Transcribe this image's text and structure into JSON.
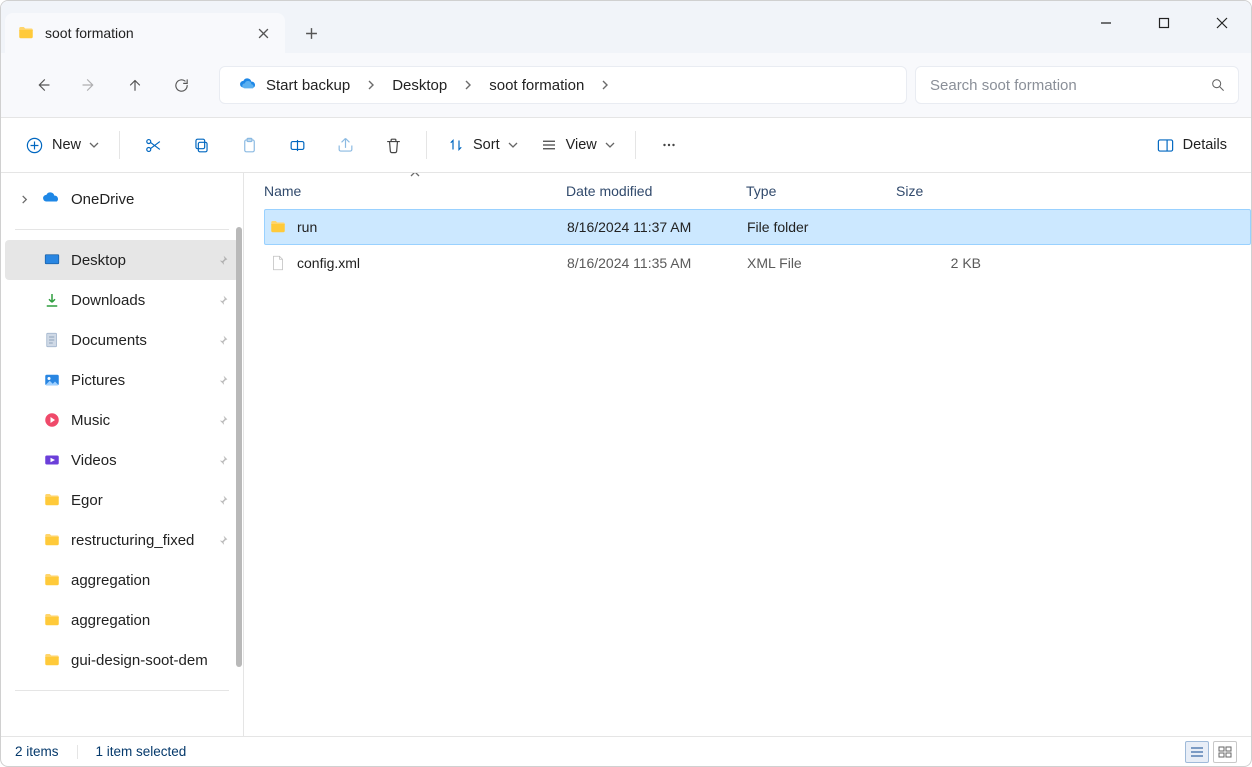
{
  "tab": {
    "title": "soot formation"
  },
  "breadcrumbs": {
    "root_icon": "onedrive-icon",
    "root_label": "Start backup",
    "items": [
      "Desktop",
      "soot formation"
    ]
  },
  "search": {
    "placeholder": "Search soot formation"
  },
  "toolbar": {
    "new_label": "New",
    "sort_label": "Sort",
    "view_label": "View",
    "details_label": "Details"
  },
  "sidebar": {
    "onedrive_label": "OneDrive",
    "items": [
      {
        "label": "Desktop",
        "icon": "desktop",
        "selected": true,
        "pinned": true
      },
      {
        "label": "Downloads",
        "icon": "downloads",
        "pinned": true
      },
      {
        "label": "Documents",
        "icon": "documents",
        "pinned": true
      },
      {
        "label": "Pictures",
        "icon": "pictures",
        "pinned": true
      },
      {
        "label": "Music",
        "icon": "music",
        "pinned": true
      },
      {
        "label": "Videos",
        "icon": "videos",
        "pinned": true
      },
      {
        "label": "Egor",
        "icon": "folder",
        "pinned": true
      },
      {
        "label": "restructuring_fixed",
        "icon": "folder",
        "pinned": true
      },
      {
        "label": "aggregation",
        "icon": "folder",
        "pinned": false
      },
      {
        "label": "aggregation",
        "icon": "folder",
        "pinned": false
      },
      {
        "label": "gui-design-soot-dem",
        "icon": "folder",
        "pinned": false
      }
    ]
  },
  "columns": {
    "name": "Name",
    "date": "Date modified",
    "type": "Type",
    "size": "Size"
  },
  "rows": [
    {
      "name": "run",
      "icon": "folder",
      "date": "8/16/2024 11:37 AM",
      "type": "File folder",
      "size": "",
      "selected": true
    },
    {
      "name": "config.xml",
      "icon": "file",
      "date": "8/16/2024 11:35 AM",
      "type": "XML File",
      "size": "2 KB",
      "selected": false
    }
  ],
  "status": {
    "items_count": "2 items",
    "selected_count": "1 item selected"
  }
}
